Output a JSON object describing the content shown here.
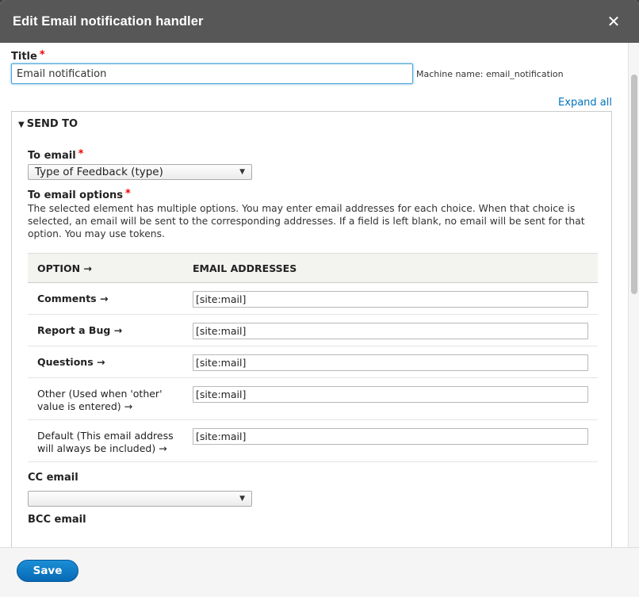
{
  "dialog": {
    "title": "Edit Email notification handler",
    "close_symbol": "✕"
  },
  "title_field": {
    "label": "Title",
    "required_mark": "*",
    "value": "Email notification",
    "machine_name": "Machine name: email_notification"
  },
  "expand_all": "Expand all",
  "send_to": {
    "summary": "SEND TO",
    "to_email": {
      "label": "To email",
      "required_mark": "*",
      "selected": "Type of Feedback (type)"
    },
    "to_email_options": {
      "label": "To email options",
      "required_mark": "*",
      "description": "The selected element has multiple options. You may enter email addresses for each choice. When that choice is selected, an email will be sent to the corresponding addresses. If a field is left blank, no email will be sent for that option. You may use tokens."
    },
    "table": {
      "headers": [
        "OPTION →",
        "EMAIL ADDRESSES"
      ],
      "rows": [
        {
          "option": "Comments →",
          "email": "[site:mail]"
        },
        {
          "option": "Report a Bug →",
          "email": "[site:mail]"
        },
        {
          "option": "Questions →",
          "email": "[site:mail]"
        },
        {
          "option": "Other (Used when 'other' value is entered) →",
          "email": "[site:mail]"
        },
        {
          "option": "Default (This email address will always be included) →",
          "email": "[site:mail]"
        }
      ]
    },
    "cc_email": {
      "label": "CC email",
      "selected": ""
    },
    "bcc_email": {
      "label": "BCC email"
    }
  },
  "footer": {
    "save_label": "Save"
  },
  "colors": {
    "titlebar": "#575757",
    "link": "#0074bd",
    "primary_button": "#0769b5",
    "required": "#e00000"
  }
}
